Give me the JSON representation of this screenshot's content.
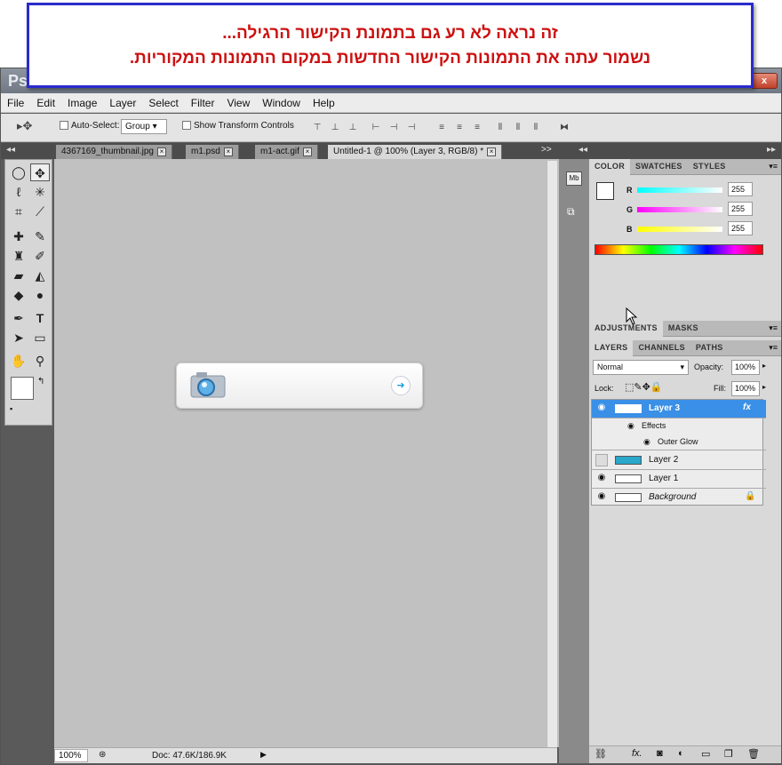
{
  "banner": {
    "line1": "זה נראה לא רע גם בתמונת הקישור הרגילה...",
    "line2": "נשמור עתה את התמונות הקישור החדשות במקום התמונות המקוריות."
  },
  "window": {
    "title": "Ps",
    "close_label": "x"
  },
  "menu": [
    "File",
    "Edit",
    "Image",
    "Layer",
    "Select",
    "Filter",
    "View",
    "Window",
    "Help"
  ],
  "options": {
    "auto_select_label": "Auto-Select:",
    "auto_select_value": "Group",
    "transform_label": "Show Transform Controls"
  },
  "doc_tabs": [
    {
      "label": "4367169_thumbnail.jpg"
    },
    {
      "label": "m1.psd"
    },
    {
      "label": "m1-act.gif"
    },
    {
      "label": "Untitled-1 @ 100% (Layer 3, RGB/8) *"
    }
  ],
  "status": {
    "zoom": "100%",
    "doc": "Doc: 47.6K/186.9K"
  },
  "panels": {
    "color_tabs": [
      "COLOR",
      "SWATCHES",
      "STYLES"
    ],
    "rgb": [
      {
        "label": "R",
        "value": "255",
        "color": "#00e5e5"
      },
      {
        "label": "G",
        "value": "255",
        "color": "#e000e0"
      },
      {
        "label": "B",
        "value": "255",
        "color": "#e5e500"
      }
    ],
    "adj_tabs": [
      "ADJUSTMENTS",
      "MASKS"
    ],
    "layer_tabs": [
      "LAYERS",
      "CHANNELS",
      "PATHS"
    ],
    "blend_mode": "Normal",
    "opacity_label": "Opacity:",
    "opacity_value": "100%",
    "lock_label": "Lock:",
    "fill_label": "Fill:",
    "fill_value": "100%",
    "layers": [
      {
        "name": "Layer 3",
        "selected": true,
        "fx": "fx"
      },
      {
        "name": "Effects"
      },
      {
        "name": "Outer Glow"
      },
      {
        "name": "Layer 2"
      },
      {
        "name": "Layer 1"
      },
      {
        "name": "Background"
      }
    ]
  }
}
